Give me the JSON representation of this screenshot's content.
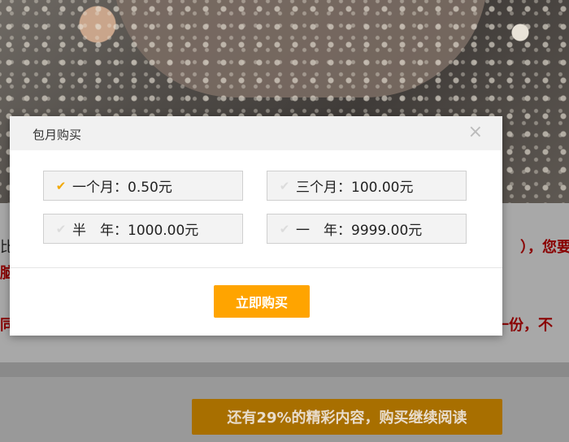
{
  "dialog": {
    "title": "包月购买",
    "close_label": "×",
    "options": [
      {
        "label": "一个月：0.50元",
        "selected": true
      },
      {
        "label": "三个月：100.00元",
        "selected": false
      },
      {
        "label": "半　年：1000.00元",
        "selected": false
      },
      {
        "label": "一　年：9999.00元",
        "selected": false
      }
    ],
    "check_glyph": "✔",
    "buy_label": "立即购买",
    "accent_color": "#ffa400"
  },
  "article": {
    "fragments": [
      "比",
      "），您要",
      "脑",
      "同",
      "再一份，不"
    ]
  },
  "continue_button": {
    "label": "还有29%的精彩内容，购买继续阅读"
  }
}
